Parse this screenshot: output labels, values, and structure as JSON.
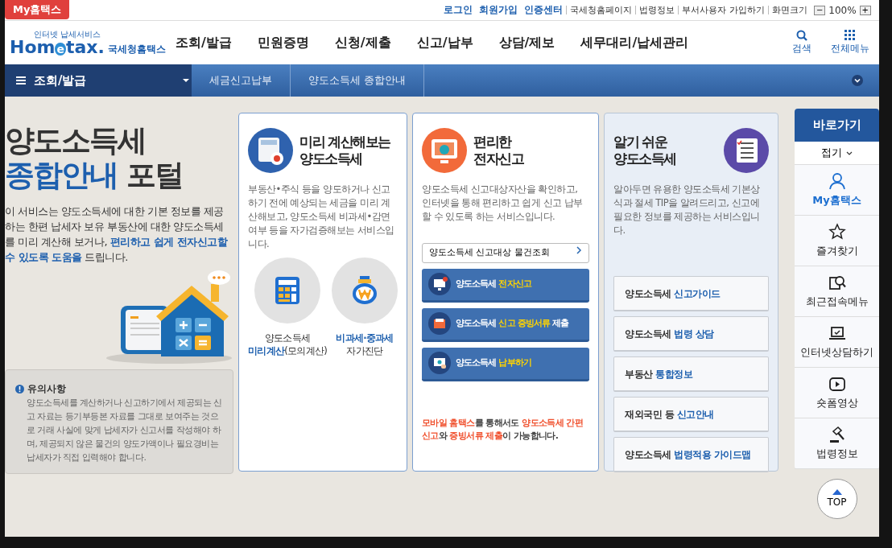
{
  "my_hometax_tab": "My홈택스",
  "top_links": [
    {
      "label": "로그인",
      "kind": "primary"
    },
    {
      "label": "회원가입",
      "kind": "primary"
    },
    {
      "label": "인증센터",
      "kind": "primary"
    },
    {
      "label": "국세청홈페이지",
      "kind": "plain"
    },
    {
      "label": "법령정보",
      "kind": "plain"
    },
    {
      "label": "부서사용자 가입하기",
      "kind": "plain"
    }
  ],
  "zoom": {
    "label": "화면크기",
    "decrease": "−",
    "value": "100%",
    "increase": "+"
  },
  "logo": {
    "tagline": "인터넷 납세서비스",
    "brand": [
      "Hom",
      "e",
      "tax."
    ],
    "name": "국세청홈택스"
  },
  "main_menu": [
    "조회/발급",
    "민원증명",
    "신청/제출",
    "신고/납부",
    "상담/제보",
    "세무대리/납세관리"
  ],
  "header_tools": [
    {
      "label": "검색",
      "kind": "search"
    },
    {
      "label": "전체메뉴",
      "kind": "grid"
    }
  ],
  "breadcrumb": {
    "menu": "조회/발급",
    "items": [
      "세금신고납부",
      "양도소득세 종합안내"
    ]
  },
  "hero": {
    "title_line1": "양도소득세",
    "title_line2": [
      {
        "text": "종합안내",
        "emphasis": true
      },
      {
        "text": " 포털",
        "emphasis": false
      }
    ],
    "description": [
      {
        "text": "이 서비스는 양도소득세에 대한 기본 정보를 제공하는 한편 납세자 보유 부동산에 대한 양도소득세를 미리 계산해 보거나, ",
        "emphasis": false
      },
      {
        "text": "편리하고 쉽게 전자신고할 수 있도록 도움을",
        "emphasis": true
      },
      {
        "text": " 드립니다.",
        "emphasis": false
      }
    ]
  },
  "notice": {
    "title": "유의사항",
    "text": "양도소득세를 계산하거나 신고하기에서 제공되는 신고 자료는 등기부등본 자료를 그대로 보여주는 것으로 거래 사실에 맞게 납세자가 신고서를 작성해야 하며, 제공되지 않은 물건의 양도가액이나 필요경비는 납세자가 직접 입력해야 합니다."
  },
  "cards": [
    {
      "kind": "calculate",
      "title": [
        "미리 계산해보는",
        "양도소득세"
      ],
      "description": "부동산•주식 등을 양도하거나 신고하기 전에 예상되는 세금을 미리 계산해보고, 양도소득세 비과세•감면여부 등을 자가검증해보는 서비스입니다.",
      "features": [
        {
          "lines": [
            [
              {
                "text": "양도소득세",
                "emphasis": false
              }
            ],
            [
              {
                "text": "미리계산",
                "emphasis": true
              },
              {
                "text": "(모의계산)",
                "emphasis": false
              }
            ]
          ]
        },
        {
          "lines": [
            [
              {
                "text": "비과세·중과세",
                "emphasis": true
              }
            ],
            [
              {
                "text": "자가진단",
                "emphasis": false
              }
            ]
          ]
        }
      ]
    },
    {
      "kind": "efile",
      "title": [
        "편리한",
        "전자신고"
      ],
      "description": "양도소득세 신고대상자산을 확인하고, 인터넷을 통해 편리하고 쉽게 신고 납부할 수 있도록 하는 서비스입니다.",
      "lookup": "양도소득세 신고대상 물건조회",
      "actions": [
        {
          "label": [
            {
              "text": "양도소득세 ",
              "emphasis": false
            },
            {
              "text": "전자신고",
              "emphasis": true
            }
          ]
        },
        {
          "label": [
            {
              "text": "양도소득세 ",
              "emphasis": false
            },
            {
              "text": "신고 증빙서류",
              "emphasis": true
            },
            {
              "text": " 제출",
              "emphasis": false
            }
          ]
        },
        {
          "label": [
            {
              "text": "양도소득세 ",
              "emphasis": false
            },
            {
              "text": "납부하기",
              "emphasis": true
            }
          ]
        }
      ],
      "note": [
        {
          "text": "모바일 홈택스",
          "emphasis": true
        },
        {
          "text": "를 통해서도 ",
          "emphasis": false
        },
        {
          "text": "양도소득세 간편신고",
          "emphasis": true
        },
        {
          "text": "와 ",
          "emphasis": false
        },
        {
          "text": "증빙서류 제출",
          "emphasis": true
        },
        {
          "text": "이 가능합니다.",
          "emphasis": false
        }
      ]
    },
    {
      "kind": "guide",
      "title": [
        "알기 쉬운",
        "양도소득세"
      ],
      "description": "알아두면 유용한 양도소득세 기본상식과 절세 TIP을 알려드리고, 신고에 필요한 정보를 제공하는 서비스입니다.",
      "links": [
        [
          {
            "text": "양도소득세 ",
            "emphasis": false
          },
          {
            "text": "신고가이드",
            "emphasis": true
          }
        ],
        [
          {
            "text": "양도소득세 ",
            "emphasis": false
          },
          {
            "text": "법령 상담",
            "emphasis": true
          }
        ],
        [
          {
            "text": "부동산 ",
            "emphasis": false
          },
          {
            "text": "통합정보",
            "emphasis": true
          }
        ],
        [
          {
            "text": "재외국민 등 ",
            "emphasis": false
          },
          {
            "text": "신고안내",
            "emphasis": true
          }
        ],
        [
          {
            "text": "양도소득세 ",
            "emphasis": false
          },
          {
            "text": "법령적용 가이드맵",
            "emphasis": true
          }
        ]
      ]
    }
  ],
  "quick_menu": {
    "title": "바로가기",
    "fold": "접기",
    "items": [
      {
        "label": "My홈택스",
        "selected": true
      },
      {
        "label": "즐겨찾기",
        "selected": false
      },
      {
        "label": "최근접속메뉴",
        "selected": false
      },
      {
        "label": "인터넷상담하기",
        "selected": false
      },
      {
        "label": "숏폼영상",
        "selected": false
      },
      {
        "label": "법령정보",
        "selected": false
      }
    ]
  },
  "top_button": "TOP"
}
